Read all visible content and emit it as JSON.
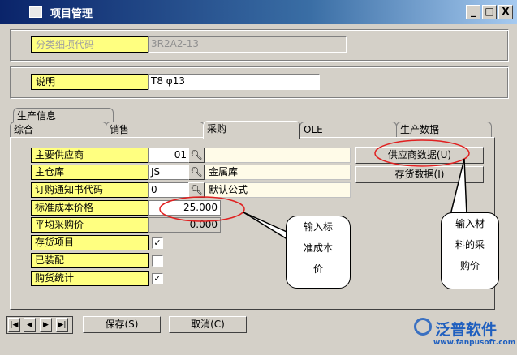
{
  "window": {
    "title": "项目管理",
    "minimize": "_",
    "maximize": "□",
    "close": "X"
  },
  "category_code": {
    "label": "分类细项代码",
    "value": "3R2A2-13"
  },
  "description": {
    "label": "说明",
    "value": "T8 φ13"
  },
  "tabs": {
    "production_info": "生产信息",
    "general": "综合",
    "sales": "销售",
    "purchasing": "采购",
    "ole": "OLE",
    "production_data": "生产数据"
  },
  "fields": {
    "main_supplier": {
      "label": "主要供应商",
      "value": "01",
      "desc": ""
    },
    "main_warehouse": {
      "label": "主仓库",
      "value": "JS",
      "desc": "金属库"
    },
    "order_notice_code": {
      "label": "订购通知书代码",
      "value": "0",
      "desc": "默认公式"
    },
    "std_cost_price": {
      "label": "标准成本价格",
      "value": "25.000"
    },
    "avg_purchase_price": {
      "label": "平均采购价",
      "value": "0.000"
    },
    "inventory_item": {
      "label": "存货项目",
      "checked": true,
      "mark": "✓"
    },
    "assembled": {
      "label": "已装配",
      "checked": false,
      "mark": ""
    },
    "purchase_stats": {
      "label": "购货统计",
      "checked": true,
      "mark": "✓"
    }
  },
  "buttons": {
    "supplier_data": "供应商数据(U)",
    "inventory_data": "存货数据(I)",
    "save": "保存(S)",
    "cancel": "取消(C)"
  },
  "nav": {
    "first": "|◀",
    "prev": "◀",
    "next": "▶",
    "last": "▶|"
  },
  "callouts": {
    "std_cost": [
      "输入标",
      "准成本",
      "价"
    ],
    "material_price": [
      "输入材",
      "料的采",
      "购价"
    ]
  },
  "brand": {
    "name": "泛普软件",
    "url": "www.fanpusoft.com",
    "color": "#1f5fbf"
  },
  "colors": {
    "label_bg": "#ffff80",
    "highlight": "#e02020"
  }
}
